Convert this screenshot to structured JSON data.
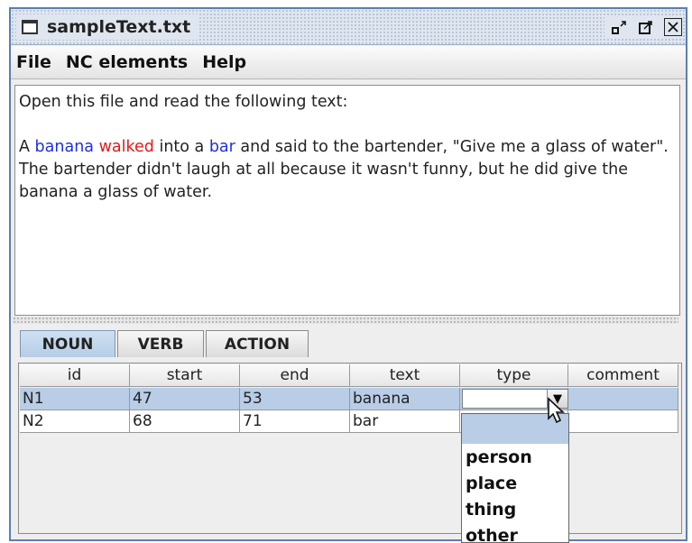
{
  "window": {
    "title": "sampleText.txt"
  },
  "menu": [
    "File",
    "NC elements",
    "Help"
  ],
  "text": {
    "line1": "Open this file and read the following text:",
    "p_a": "A ",
    "w_banana": "banana",
    "w_walked": "walked",
    "p_b": " into a ",
    "w_bar": "bar",
    "p_c": " and said to the bartender, \"Give me a glass of water\".  The bartender didn't laugh at all because it wasn't funny, but he did give the banana a glass of water."
  },
  "tabs": [
    "NOUN",
    "VERB",
    "ACTION"
  ],
  "table": {
    "columns": [
      "id",
      "start",
      "end",
      "text",
      "type",
      "comment"
    ],
    "rows": [
      [
        "N1",
        "47",
        "53",
        "banana",
        "",
        ""
      ],
      [
        "N2",
        "68",
        "71",
        "bar",
        "",
        ""
      ]
    ]
  },
  "type_options": [
    "",
    "person",
    "place",
    "thing",
    "other"
  ],
  "colors": {
    "accent": "#b9cde6",
    "blue_word": "#1f31e0",
    "red_word": "#e01919"
  }
}
